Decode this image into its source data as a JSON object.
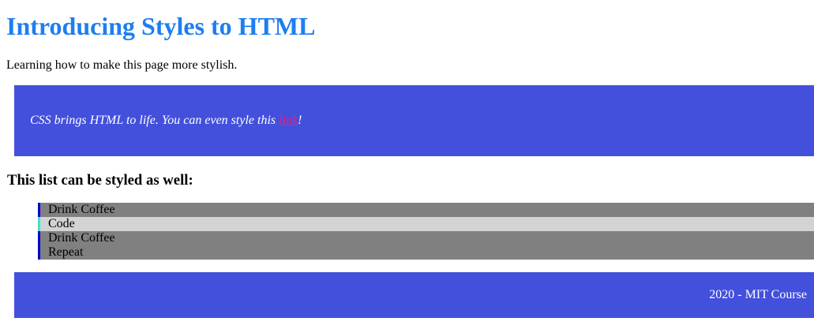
{
  "page": {
    "title": "Introducing Styles to HTML",
    "intro": "Learning how to make this page more stylish."
  },
  "quote": {
    "text_before": "CSS brings HTML to life. You can even style this ",
    "link_label": "link",
    "text_after": "!"
  },
  "list": {
    "heading": "This list can be styled as well:",
    "items": [
      {
        "label": "Drink Coffee",
        "background": "#808080",
        "accent": "#0000cc"
      },
      {
        "label": "Code",
        "background": "#d3d3d3",
        "accent": "#40e0d0"
      },
      {
        "label": "Drink Coffee",
        "background": "#808080",
        "accent": "#0000cc"
      },
      {
        "label": "Repeat",
        "background": "#808080",
        "accent": "#0000cc"
      }
    ]
  },
  "footer": {
    "text": "2020 - MIT Course"
  },
  "colors": {
    "title": "#1e7ef0",
    "panel": "#4350dc",
    "panel_text": "#ffffff",
    "link": "#e0218a"
  }
}
